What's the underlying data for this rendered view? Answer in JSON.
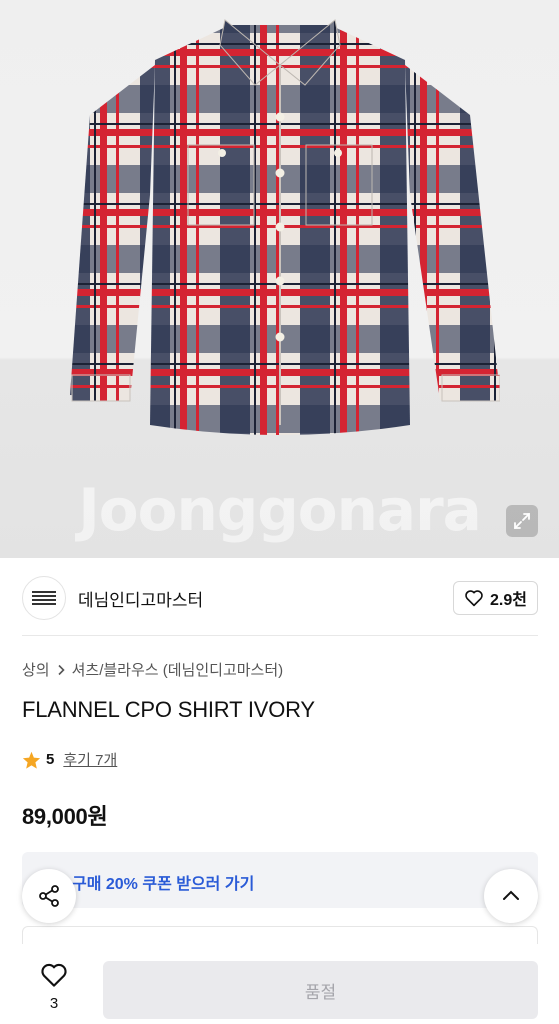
{
  "product_image": {
    "watermark": "Joonggonara",
    "expand_icon": "expand-icon"
  },
  "seller": {
    "name": "데님인디고마스터",
    "wish_count": "2.9천",
    "heart_icon": "heart-outline-icon"
  },
  "product": {
    "breadcrumb_category": "상의",
    "breadcrumb_subcategory": "셔츠/블라우스 (데님인디고마스터)",
    "title": "FLANNEL CPO SHIRT IVORY",
    "rating": "5",
    "reviews_label": "후기 7개",
    "price": "89,000원"
  },
  "coupon": {
    "text": "구매 20% 쿠폰 받으러 가기"
  },
  "bottom_bar": {
    "like_count": "3",
    "buy_button_label": "품절"
  },
  "colors": {
    "coupon_text": "#2a5bd7",
    "star": "#f5a623",
    "soldout_bg": "#eaeaed"
  }
}
